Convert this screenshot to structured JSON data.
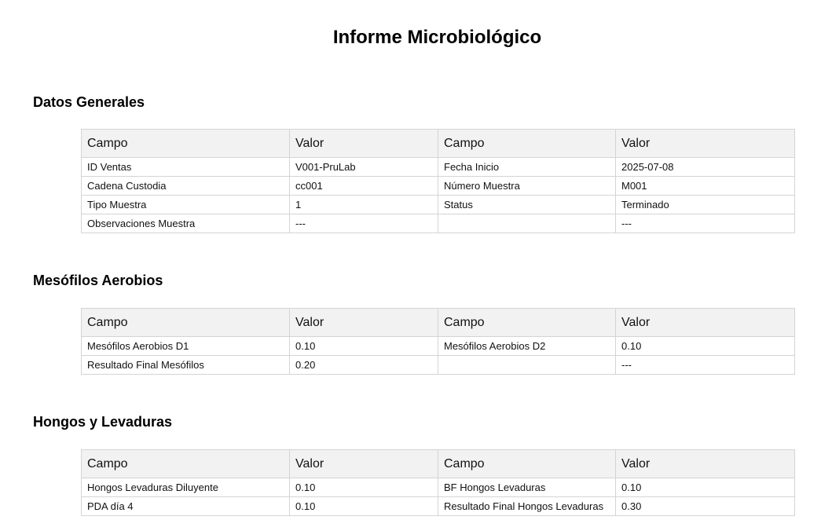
{
  "document": {
    "title": "Informe Microbiológico"
  },
  "table_headers": [
    "Campo",
    "Valor",
    "Campo",
    "Valor"
  ],
  "sections": [
    {
      "title": "Datos Generales",
      "rows": [
        [
          "ID Ventas",
          "V001-PruLab",
          "Fecha Inicio",
          "2025-07-08"
        ],
        [
          "Cadena Custodia",
          "cc001",
          "Número Muestra",
          "M001"
        ],
        [
          "Tipo Muestra",
          "1",
          "Status",
          "Terminado"
        ],
        [
          "Observaciones Muestra",
          "---",
          "",
          "---"
        ]
      ]
    },
    {
      "title": "Mesófilos Aerobios",
      "rows": [
        [
          "Mesófilos Aerobios D1",
          "0.10",
          "Mesófilos Aerobios D2",
          "0.10"
        ],
        [
          "Resultado Final Mesófilos",
          "0.20",
          "",
          "---"
        ]
      ]
    },
    {
      "title": "Hongos y Levaduras",
      "rows": [
        [
          "Hongos Levaduras Diluyente",
          "0.10",
          "BF Hongos Levaduras",
          "0.10"
        ],
        [
          "PDA día 4",
          "0.10",
          "Resultado Final Hongos Levaduras",
          "0.30"
        ]
      ]
    }
  ]
}
